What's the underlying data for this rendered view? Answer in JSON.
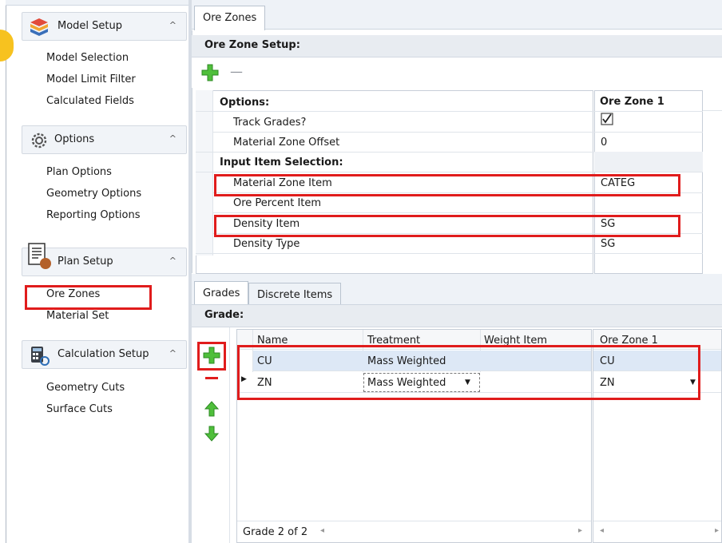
{
  "sidebar": {
    "groups": [
      {
        "label": "Model Setup",
        "icon": "layered-cube-icon",
        "items": [
          "Model Selection",
          "Model Limit Filter",
          "Calculated Fields"
        ]
      },
      {
        "label": "Options",
        "icon": "gears-icon",
        "items": [
          "Plan Options",
          "Geometry Options",
          "Reporting Options"
        ]
      },
      {
        "label": "Plan Setup",
        "icon": "document-cube-icon",
        "items": [
          "Ore Zones",
          "Material Set"
        ]
      },
      {
        "label": "Calculation Setup",
        "icon": "calculator-icon",
        "items": [
          "Geometry Cuts",
          "Surface Cuts"
        ]
      }
    ],
    "collapse_glyph": "^"
  },
  "main": {
    "tab": "Ore Zones",
    "section_title": "Ore Zone Setup:",
    "minus_glyph": "—",
    "properties": {
      "col_header": "Ore Zone 1",
      "options_heading": "Options:",
      "track_grades_label": "Track Grades?",
      "track_grades_checked": true,
      "material_zone_offset_label": "Material Zone Offset",
      "material_zone_offset_value": "0",
      "input_heading": "Input Item Selection:",
      "material_zone_item_label": "Material Zone Item",
      "material_zone_item_value": "CATEG",
      "ore_percent_item_label": "Ore Percent Item",
      "ore_percent_item_value": "",
      "density_item_label": "Density Item",
      "density_item_value": "SG",
      "density_type_label": "Density Type",
      "density_type_value": "SG"
    },
    "bottom_tabs": [
      "Grades",
      "Discrete Items"
    ],
    "grade_title": "Grade:",
    "grade_table": {
      "columns": [
        "Name",
        "Treatment",
        "Weight Item"
      ],
      "right_column": "Ore Zone 1",
      "rows": [
        {
          "name": "CU",
          "treatment": "Mass Weighted",
          "weight": "",
          "zone": "CU"
        },
        {
          "name": "ZN",
          "treatment": "Mass Weighted",
          "weight": "",
          "zone": "ZN"
        }
      ],
      "pager": "Grade 2 of 2"
    }
  },
  "colors": {
    "accent_red": "#e01c1c",
    "green": "#3fae2f",
    "highlight_yellow": "#f7c21f"
  }
}
